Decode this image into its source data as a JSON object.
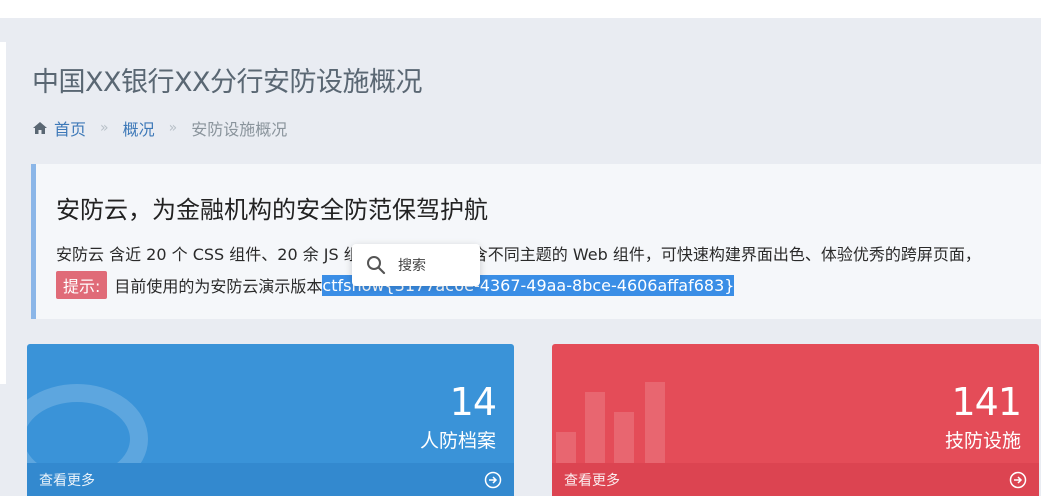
{
  "page": {
    "title": "中国XX银行XX分行安防设施概况"
  },
  "breadcrumb": {
    "icon": "home-icon",
    "items": [
      "首页",
      "概况",
      "安防设施概况"
    ],
    "separator": "»"
  },
  "callout": {
    "title": "安防云，为金融机构的安全防范保驾护航",
    "text": "安防云 含近 20 个 CSS 组件、20 余 JS 组件，更有多个包含不同主题的 Web 组件，可快速构建界面出色、体验优秀的跨屏页面，",
    "tip_label": "提示:",
    "line2_prefix": "目前使用的为安防云演示版本",
    "flag": "ctfshow{3177ac6e-4367-49aa-8bce-4606affaf683}",
    "border_color": "#8bb6e8"
  },
  "search_popup": {
    "icon": "search-icon",
    "label": "搜索"
  },
  "cards": [
    {
      "count": "14",
      "label": "人防档案",
      "more": "查看更多",
      "color": "#3a93d8",
      "icon": "chat-bubble-icon"
    },
    {
      "count": "141",
      "label": "技防设施",
      "more": "查看更多",
      "color": "#e44c58",
      "icon": "bar-chart-icon"
    }
  ]
}
